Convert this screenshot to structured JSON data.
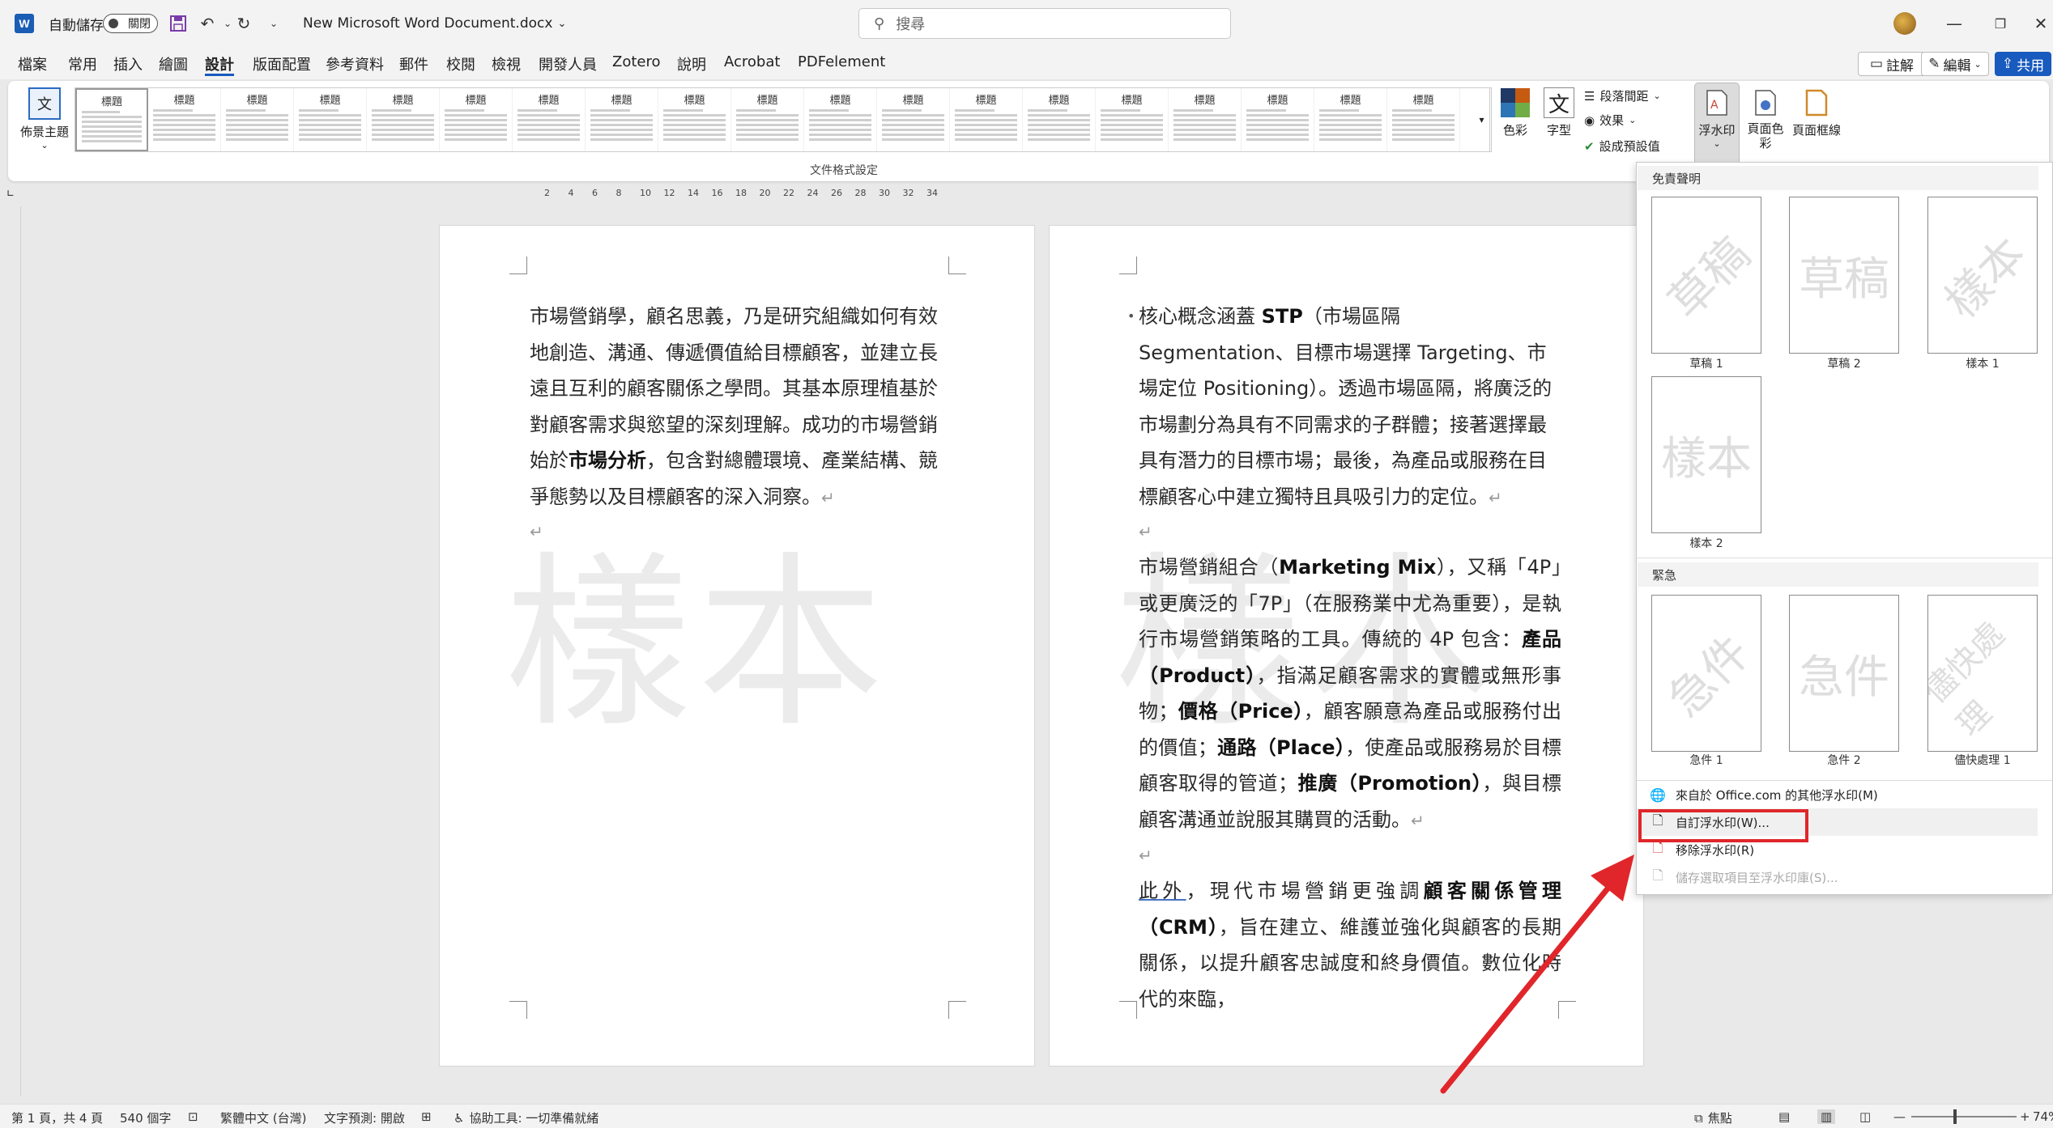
{
  "titlebar": {
    "autosave_label": "自動儲存",
    "autosave_state": "關閉",
    "doc_title": "New Microsoft Word Document.docx",
    "search_placeholder": "搜尋"
  },
  "menu": {
    "tabs": [
      "檔案",
      "常用",
      "插入",
      "繪圖",
      "設計",
      "版面配置",
      "參考資料",
      "郵件",
      "校閱",
      "檢視",
      "開發人員",
      "Zotero",
      "說明",
      "Acrobat",
      "PDFelement"
    ],
    "active": "設計",
    "comments_label": "註解",
    "editing_label": "編輯",
    "share_label": "共用"
  },
  "ribbon": {
    "themes_label": "佈景主題",
    "group_label": "文件格式設定",
    "style_titles": [
      "標題",
      "標題",
      "標題",
      "標題",
      "標題",
      "標題",
      "標題",
      "標題",
      "標題",
      "標題",
      "標題",
      "標題",
      "標題",
      "標題",
      "標題",
      "標題",
      "標題",
      "標題",
      "標題"
    ],
    "colors_label": "色彩",
    "fonts_label": "字型",
    "paragraph_spacing_label": "段落間距",
    "effects_label": "效果",
    "set_default_label": "設成預設值",
    "watermark_label": "浮水印",
    "page_color_label": "頁面色彩",
    "page_borders_label": "頁面框線"
  },
  "ruler": {
    "ticks": [
      "2",
      "4",
      "6",
      "8",
      "10",
      "12",
      "14",
      "16",
      "18",
      "20",
      "22",
      "24",
      "26",
      "28",
      "30",
      "32",
      "34"
    ]
  },
  "page1": {
    "watermark": "樣本",
    "para1": "市場營銷學，顧名思義，乃是研究組織如何有效地創造、溝通、傳遞價值給目標顧客，並建立長遠且互利的顧客關係之學問。其基本原理植基於對顧客需求與慾望的深刻理解。成功的市場營銷始於",
    "para1_bold": "市場分析",
    "para1_tail": "，包含對總體環境、產業結構、競爭態勢以及目標顧客的深入洞察。"
  },
  "page2": {
    "watermark": "樣本",
    "p1_a": "核心概念涵蓋 ",
    "p1_b": "STP",
    "p1_c": "（市場區隔 Segmentation、目標市場選擇 Targeting、市場定位 Positioning）。透過市場區隔，將廣泛的市場劃分為具有不同需求的子群體；接著選擇最具有潛力的目標市場；最後，為產品或服務在目標顧客心中建立獨特且具吸引力的定位。",
    "p2_a": "市場營銷組合（",
    "p2_b": "Marketing Mix",
    "p2_c": "），又稱「4P」或更廣泛的「7P」（在服務業中尤為重要），是執行市場營銷策略的工具。傳統的 4P 包含：",
    "p2_d": "產品（Product）",
    "p2_e": "，指滿足顧客需求的實體或無形事物；",
    "p2_f": "價格（Price）",
    "p2_g": "，顧客願意為產品或服務付出的價值；",
    "p2_h": "通路（Place）",
    "p2_i": "，使產品或服務易於目標顧客取得的管道；",
    "p2_j": "推廣（Promotion）",
    "p2_k": "，與目標顧客溝通並說服其購買的活動。",
    "p3_a": "此外",
    "p3_b": "，現代市場營銷更強調",
    "p3_c": "顧客關係管理（CRM）",
    "p3_d": "，旨在建立、維護並強化與顧客的長期關係，以提升顧客忠誠度和終身價值。數位化時代的來臨，"
  },
  "watermark_menu": {
    "section1": "免責聲明",
    "section2": "緊急",
    "thumbs1": [
      {
        "text": "草稿",
        "caption": "草稿 1",
        "diag": true
      },
      {
        "text": "草稿",
        "caption": "草稿 2",
        "diag": false
      },
      {
        "text": "樣本",
        "caption": "樣本 1",
        "diag": true
      },
      {
        "text": "樣本",
        "caption": "樣本 2",
        "diag": false
      }
    ],
    "thumbs2": [
      {
        "text": "急件",
        "caption": "急件 1",
        "diag": true
      },
      {
        "text": "急件",
        "caption": "急件 2",
        "diag": false
      },
      {
        "text": "儘快處理",
        "caption": "儘快處理 1",
        "diag": true
      }
    ],
    "more_online": "來自於 Office.com 的其他浮水印(M)",
    "custom": "自訂浮水印(W)...",
    "remove": "移除浮水印(R)",
    "save_selection": "儲存選取項目至浮水印庫(S)..."
  },
  "status": {
    "page": "第 1 頁，共 4 頁",
    "words": "540 個字",
    "language": "繁體中文 (台灣)",
    "text_prediction": "文字預測: 開啟",
    "accessibility": "協助工具: 一切準備就緒",
    "focus": "焦點",
    "zoom": "74%"
  },
  "colors": {
    "accent": "#185abd",
    "highlight": "#e0262a"
  }
}
